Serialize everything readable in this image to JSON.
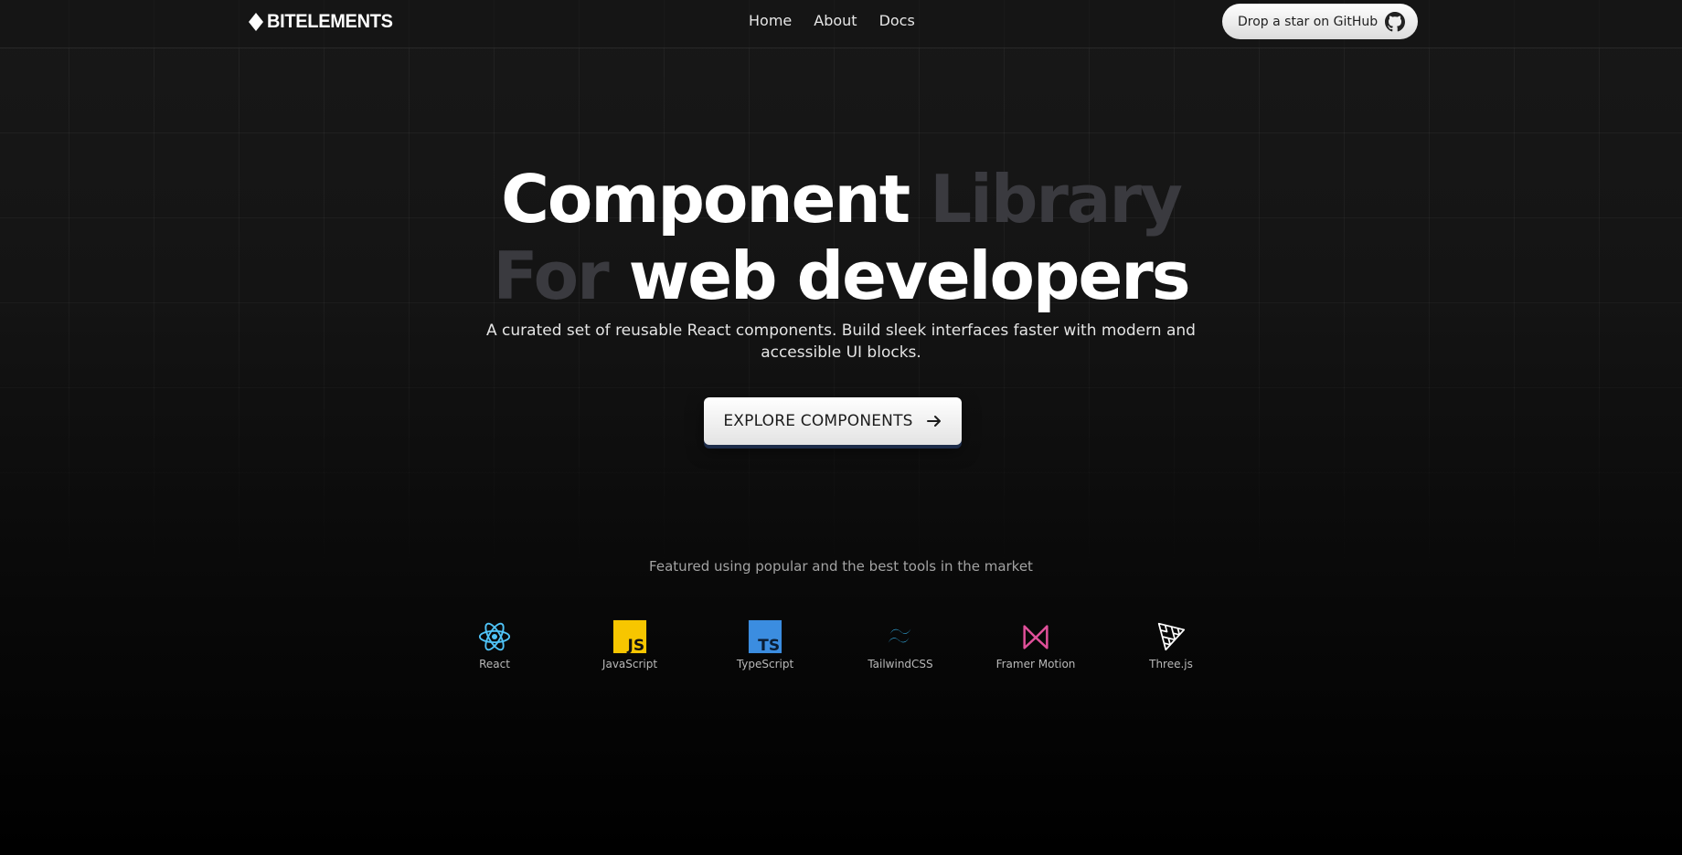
{
  "brand": {
    "logo_text": "BITELEMENTS"
  },
  "nav": {
    "links": [
      {
        "label": "Home"
      },
      {
        "label": "About"
      },
      {
        "label": "Docs"
      }
    ],
    "github_label": "Drop a star on GitHub"
  },
  "hero": {
    "line1_bright": "Component",
    "line1_dim": "Library",
    "line2_dim": "For",
    "line2_bright": "web developers",
    "subtitle": "A curated set of reusable React components. Build sleek interfaces faster with modern and accessible UI blocks.",
    "cta_label": "EXPLORE COMPONENTS"
  },
  "featured": {
    "heading": "Featured using popular and the best tools in the market",
    "tools": [
      {
        "label": "React",
        "icon": "react-icon",
        "color": "#4fc3f7"
      },
      {
        "label": "JavaScript",
        "icon": "javascript-icon",
        "color": "#f7c600"
      },
      {
        "label": "TypeScript",
        "icon": "typescript-icon",
        "color": "#3b8de0"
      },
      {
        "label": "TailwindCSS",
        "icon": "tailwind-icon",
        "color": "#38bdf8"
      },
      {
        "label": "Framer Motion",
        "icon": "framer-motion-icon",
        "color": "#e0509a"
      },
      {
        "label": "Three.js",
        "icon": "threejs-icon",
        "color": "#ffffff"
      }
    ]
  },
  "colors": {
    "background": "#141414",
    "accent_dim_text": "#3a3a3f",
    "cta_shadow": "#1d2c4a"
  }
}
